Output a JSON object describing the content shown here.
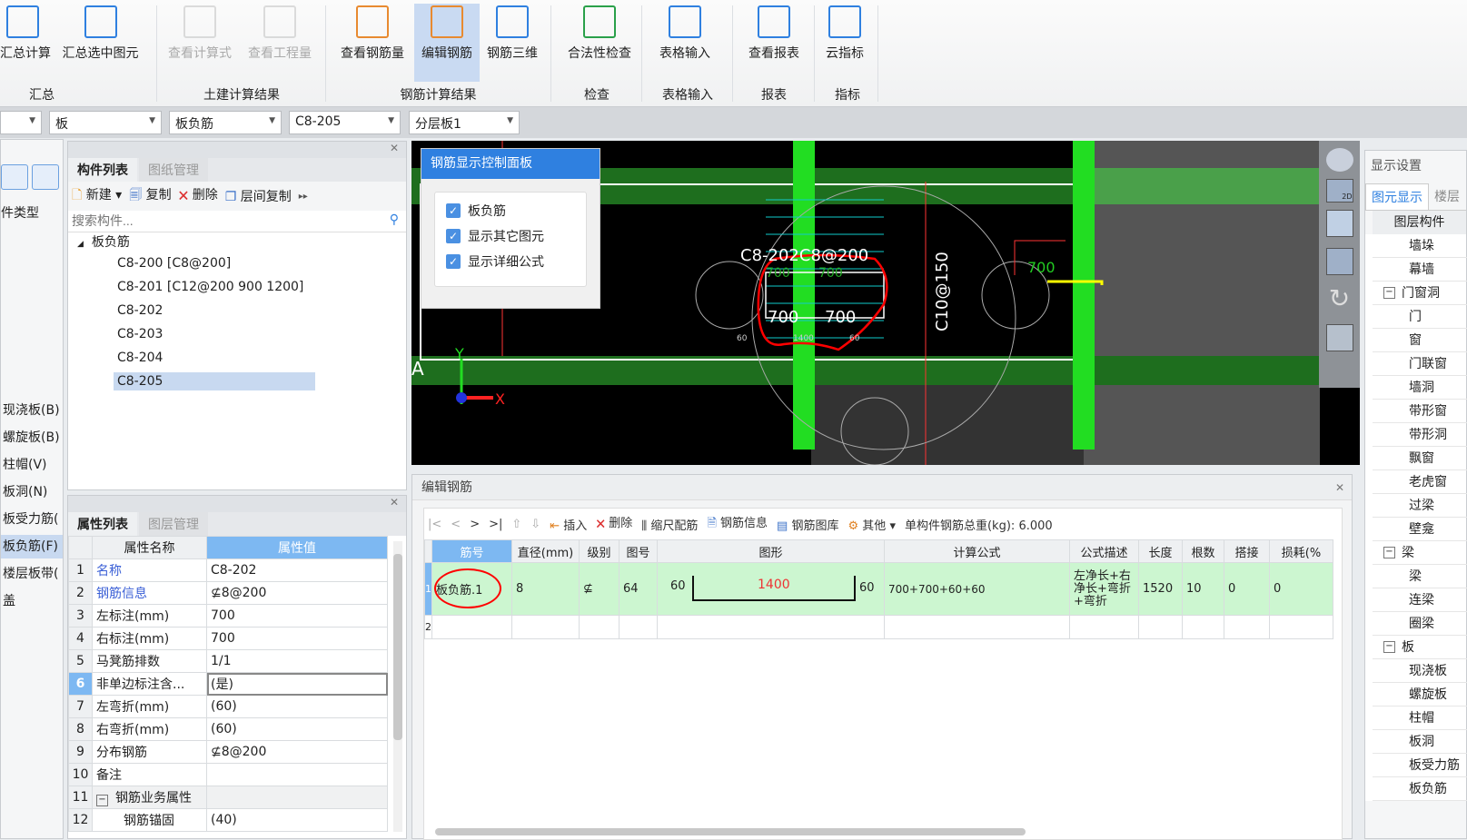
{
  "ribbon": {
    "buttons": [
      {
        "label": "汇总计算",
        "icon": "sigma-icon",
        "state": "normal"
      },
      {
        "label": "汇总选中图元",
        "icon": "calc-selected-icon",
        "state": "normal"
      },
      {
        "label": "查看计算式",
        "icon": "view-formula-icon",
        "state": "disabled"
      },
      {
        "label": "查看工程量",
        "icon": "view-quantity-icon",
        "state": "disabled"
      },
      {
        "label": "查看钢筋量",
        "icon": "view-rebar-icon",
        "state": "normal"
      },
      {
        "label": "编辑钢筋",
        "icon": "edit-rebar-icon",
        "state": "selected"
      },
      {
        "label": "钢筋三维",
        "icon": "rebar-3d-icon",
        "state": "normal"
      },
      {
        "label": "合法性检查",
        "icon": "check-icon",
        "state": "normal"
      },
      {
        "label": "表格输入",
        "icon": "table-input-icon",
        "state": "normal"
      },
      {
        "label": "查看报表",
        "icon": "report-icon",
        "state": "normal"
      },
      {
        "label": "云指标",
        "icon": "cloud-index-icon",
        "state": "normal"
      }
    ],
    "groups": [
      "汇总",
      "土建计算结果",
      "钢筋计算结果",
      "检查",
      "表格输入",
      "报表",
      "指标"
    ]
  },
  "combos": [
    "",
    "板",
    "板负筋",
    "C8-205",
    "分层板1"
  ],
  "left_col": {
    "header": "件类型",
    "items": [
      "现浇板(B)",
      "螺旋板(B)",
      "柱帽(V)",
      "板洞(N)",
      "板受力筋(",
      "板负筋(F)",
      "楼层板带(",
      "盖"
    ],
    "selected": "板负筋(F)"
  },
  "component_panel": {
    "tabs": [
      "构件列表",
      "图纸管理"
    ],
    "toolbar": [
      "新建",
      "复制",
      "删除",
      "层间复制"
    ],
    "search_placeholder": "搜索构件...",
    "tree_root": "板负筋",
    "items": [
      "C8-200 [C8@200]",
      "C8-201 [C12@200 900 1200]",
      "C8-202",
      "C8-203",
      "C8-204",
      "C8-205"
    ],
    "selected": "C8-205"
  },
  "property_panel": {
    "tabs": [
      "属性列表",
      "图层管理"
    ],
    "headers": [
      "属性名称",
      "属性值"
    ],
    "rows": [
      {
        "n": "1",
        "name": "名称",
        "value": "C8-202",
        "link": true
      },
      {
        "n": "2",
        "name": "钢筋信息",
        "value": "⊈8@200",
        "link": true
      },
      {
        "n": "3",
        "name": "左标注(mm)",
        "value": "700"
      },
      {
        "n": "4",
        "name": "右标注(mm)",
        "value": "700"
      },
      {
        "n": "5",
        "name": "马凳筋排数",
        "value": "1/1"
      },
      {
        "n": "6",
        "name": "非单边标注含...",
        "value": "(是)",
        "selected": true
      },
      {
        "n": "7",
        "name": "左弯折(mm)",
        "value": "(60)"
      },
      {
        "n": "8",
        "name": "右弯折(mm)",
        "value": "(60)"
      },
      {
        "n": "9",
        "name": "分布钢筋",
        "value": "⊈8@200"
      },
      {
        "n": "10",
        "name": "备注",
        "value": ""
      },
      {
        "n": "11",
        "name": "钢筋业务属性",
        "value": "",
        "group": true
      },
      {
        "n": "12",
        "name": "钢筋锚固",
        "value": "(40)",
        "child": true
      }
    ]
  },
  "viewport": {
    "control_panel": {
      "title": "钢筋显示控制面板",
      "options": [
        {
          "label": "板负筋",
          "checked": true
        },
        {
          "label": "显示其它图元",
          "checked": true
        },
        {
          "label": "显示详细公式",
          "checked": true
        }
      ]
    },
    "labels": {
      "rebar": "C8-202C8@200",
      "left": "700",
      "right": "700",
      "b60l": "60",
      "b1400": "1400",
      "b60r": "60",
      "vertical": "C10@150",
      "yellow": "700",
      "axis": "A",
      "x": "X",
      "y": "Y",
      "t700a": "700",
      "t700b": "700",
      "view2d": "2D"
    }
  },
  "edit_rebar": {
    "title": "编辑钢筋",
    "toolbar": {
      "nav": [
        "|<",
        "<",
        ">",
        ">|"
      ],
      "insert": "插入",
      "delete": "删除",
      "scale": "缩尺配筋",
      "info": "钢筋信息",
      "library": "钢筋图库",
      "other": "其他",
      "total_label": "单构件钢筋总重(kg):",
      "total_value": "6.000"
    },
    "headers": [
      "筋号",
      "直径(mm)",
      "级别",
      "图号",
      "图形",
      "计算公式",
      "公式描述",
      "长度",
      "根数",
      "搭接",
      "损耗(%"
    ],
    "rows": [
      {
        "n": "1",
        "id": "板负筋.1",
        "dia": "8",
        "grade": "⊈",
        "fig": "64",
        "shape": {
          "left": "60",
          "mid": "1400",
          "right": "60"
        },
        "formula": "700+700+60+60",
        "desc": "左净长+右净长+弯折+弯折",
        "len": "1520",
        "count": "10",
        "lap": "0",
        "loss": "0"
      },
      {
        "n": "2"
      }
    ]
  },
  "right_panel": {
    "title": "显示设置",
    "tabs": [
      "图元显示",
      "楼层"
    ],
    "header": "图层构件",
    "rows": [
      {
        "label": "墙垛"
      },
      {
        "label": "幕墙"
      },
      {
        "label": "门窗洞",
        "group": true
      },
      {
        "label": "门"
      },
      {
        "label": "窗"
      },
      {
        "label": "门联窗"
      },
      {
        "label": "墙洞"
      },
      {
        "label": "带形窗"
      },
      {
        "label": "带形洞"
      },
      {
        "label": "飘窗"
      },
      {
        "label": "老虎窗"
      },
      {
        "label": "过梁"
      },
      {
        "label": "壁龛"
      },
      {
        "label": "梁",
        "group": true
      },
      {
        "label": "梁"
      },
      {
        "label": "连梁"
      },
      {
        "label": "圈梁"
      },
      {
        "label": "板",
        "group": true
      },
      {
        "label": "现浇板"
      },
      {
        "label": "螺旋板"
      },
      {
        "label": "柱帽"
      },
      {
        "label": "板洞"
      },
      {
        "label": "板受力筋"
      },
      {
        "label": "板负筋"
      }
    ]
  },
  "colors": {
    "accent": "#2f80e0",
    "selection": "#c8d9f0",
    "row_green": "#ccf6d0",
    "cad_green": "#22dd22",
    "annotation_red": "#ff0000"
  }
}
